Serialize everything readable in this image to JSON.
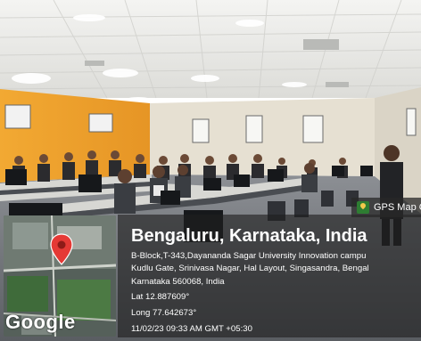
{
  "gps_overlay": {
    "badge_label": "GPS Map C",
    "place_title": "Bengaluru, Karnataka, India",
    "address_lines": [
      "B-Block,T-343,Dayananda Sagar University Innovation campu",
      "Kudlu Gate, Srinivasa Nagar, Hal Layout, Singasandra, Bengal",
      "Karnataka 560068, India"
    ],
    "latitude": "Lat 12.887609°",
    "longitude": "Long 77.642673°",
    "timestamp": "11/02/23 09:33 AM GMT +05:30",
    "map_logo": "Google"
  },
  "colors": {
    "wall_orange": "#f0a22e",
    "wall_cream": "#e6e0d2",
    "ceiling": "#ebebe8",
    "pin_red": "#e53935",
    "panel": "#1e1e1e"
  }
}
